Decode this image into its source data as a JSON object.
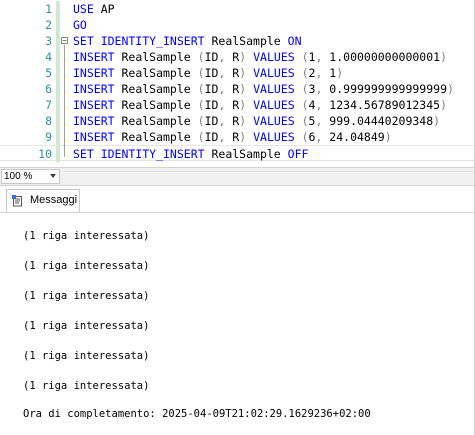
{
  "editor": {
    "lines": [
      {
        "num": "1",
        "tokens": [
          {
            "t": "USE",
            "c": "kw"
          },
          {
            "t": " AP",
            "c": "id"
          }
        ]
      },
      {
        "num": "2",
        "tokens": [
          {
            "t": "GO",
            "c": "kw"
          }
        ]
      },
      {
        "num": "3",
        "tokens": [
          {
            "t": "SET IDENTITY_INSERT",
            "c": "kw"
          },
          {
            "t": " RealSample ",
            "c": "id"
          },
          {
            "t": "ON",
            "c": "kw"
          }
        ]
      },
      {
        "num": "4",
        "tokens": [
          {
            "t": "INSERT",
            "c": "kw"
          },
          {
            "t": " RealSample ",
            "c": "id"
          },
          {
            "t": "(",
            "c": "op"
          },
          {
            "t": "ID",
            "c": "id"
          },
          {
            "t": ", ",
            "c": "op"
          },
          {
            "t": "R",
            "c": "id"
          },
          {
            "t": ") ",
            "c": "op"
          },
          {
            "t": "VALUES",
            "c": "kw"
          },
          {
            "t": " (",
            "c": "op"
          },
          {
            "t": "1",
            "c": "num"
          },
          {
            "t": ", ",
            "c": "op"
          },
          {
            "t": "1.00000000000001",
            "c": "num"
          },
          {
            "t": ")",
            "c": "op"
          }
        ]
      },
      {
        "num": "5",
        "tokens": [
          {
            "t": "INSERT",
            "c": "kw"
          },
          {
            "t": " RealSample ",
            "c": "id"
          },
          {
            "t": "(",
            "c": "op"
          },
          {
            "t": "ID",
            "c": "id"
          },
          {
            "t": ", ",
            "c": "op"
          },
          {
            "t": "R",
            "c": "id"
          },
          {
            "t": ") ",
            "c": "op"
          },
          {
            "t": "VALUES",
            "c": "kw"
          },
          {
            "t": " (",
            "c": "op"
          },
          {
            "t": "2",
            "c": "num"
          },
          {
            "t": ", ",
            "c": "op"
          },
          {
            "t": "1",
            "c": "num"
          },
          {
            "t": ")",
            "c": "op"
          }
        ]
      },
      {
        "num": "6",
        "tokens": [
          {
            "t": "INSERT",
            "c": "kw"
          },
          {
            "t": " RealSample ",
            "c": "id"
          },
          {
            "t": "(",
            "c": "op"
          },
          {
            "t": "ID",
            "c": "id"
          },
          {
            "t": ", ",
            "c": "op"
          },
          {
            "t": "R",
            "c": "id"
          },
          {
            "t": ") ",
            "c": "op"
          },
          {
            "t": "VALUES",
            "c": "kw"
          },
          {
            "t": " (",
            "c": "op"
          },
          {
            "t": "3",
            "c": "num"
          },
          {
            "t": ", ",
            "c": "op"
          },
          {
            "t": "0.999999999999999",
            "c": "num"
          },
          {
            "t": ")",
            "c": "op"
          }
        ]
      },
      {
        "num": "7",
        "tokens": [
          {
            "t": "INSERT",
            "c": "kw"
          },
          {
            "t": " RealSample ",
            "c": "id"
          },
          {
            "t": "(",
            "c": "op"
          },
          {
            "t": "ID",
            "c": "id"
          },
          {
            "t": ", ",
            "c": "op"
          },
          {
            "t": "R",
            "c": "id"
          },
          {
            "t": ") ",
            "c": "op"
          },
          {
            "t": "VALUES",
            "c": "kw"
          },
          {
            "t": " (",
            "c": "op"
          },
          {
            "t": "4",
            "c": "num"
          },
          {
            "t": ", ",
            "c": "op"
          },
          {
            "t": "1234.56789012345",
            "c": "num"
          },
          {
            "t": ")",
            "c": "op"
          }
        ]
      },
      {
        "num": "8",
        "tokens": [
          {
            "t": "INSERT",
            "c": "kw"
          },
          {
            "t": " RealSample ",
            "c": "id"
          },
          {
            "t": "(",
            "c": "op"
          },
          {
            "t": "ID",
            "c": "id"
          },
          {
            "t": ", ",
            "c": "op"
          },
          {
            "t": "R",
            "c": "id"
          },
          {
            "t": ") ",
            "c": "op"
          },
          {
            "t": "VALUES",
            "c": "kw"
          },
          {
            "t": " (",
            "c": "op"
          },
          {
            "t": "5",
            "c": "num"
          },
          {
            "t": ", ",
            "c": "op"
          },
          {
            "t": "999.04440209348",
            "c": "num"
          },
          {
            "t": ")",
            "c": "op"
          }
        ]
      },
      {
        "num": "9",
        "tokens": [
          {
            "t": "INSERT",
            "c": "kw"
          },
          {
            "t": " RealSample ",
            "c": "id"
          },
          {
            "t": "(",
            "c": "op"
          },
          {
            "t": "ID",
            "c": "id"
          },
          {
            "t": ", ",
            "c": "op"
          },
          {
            "t": "R",
            "c": "id"
          },
          {
            "t": ") ",
            "c": "op"
          },
          {
            "t": "VALUES",
            "c": "kw"
          },
          {
            "t": " (",
            "c": "op"
          },
          {
            "t": "6",
            "c": "num"
          },
          {
            "t": ", ",
            "c": "op"
          },
          {
            "t": "24.04849",
            "c": "num"
          },
          {
            "t": ")",
            "c": "op"
          }
        ]
      },
      {
        "num": "10",
        "tokens": [
          {
            "t": "SET IDENTITY_INSERT",
            "c": "kw"
          },
          {
            "t": " RealSample ",
            "c": "id"
          },
          {
            "t": "OFF",
            "c": "kw"
          }
        ]
      }
    ],
    "current_line": 10,
    "colors": {
      "keyword": "#0000ff",
      "line_number": "#2b91af",
      "operator": "#808080"
    }
  },
  "zoom": {
    "value": "100 %"
  },
  "results": {
    "tab_label": "Messaggi",
    "messages": [
      "(1 riga interessata)",
      "(1 riga interessata)",
      "(1 riga interessata)",
      "(1 riga interessata)",
      "(1 riga interessata)",
      "(1 riga interessata)"
    ],
    "completion": "Ora di completamento: 2025-04-09T21:02:29.1629236+02:00"
  },
  "icons": {
    "messages_tab": "messages-icon",
    "zoom_dropdown": "chevron-down-icon"
  }
}
